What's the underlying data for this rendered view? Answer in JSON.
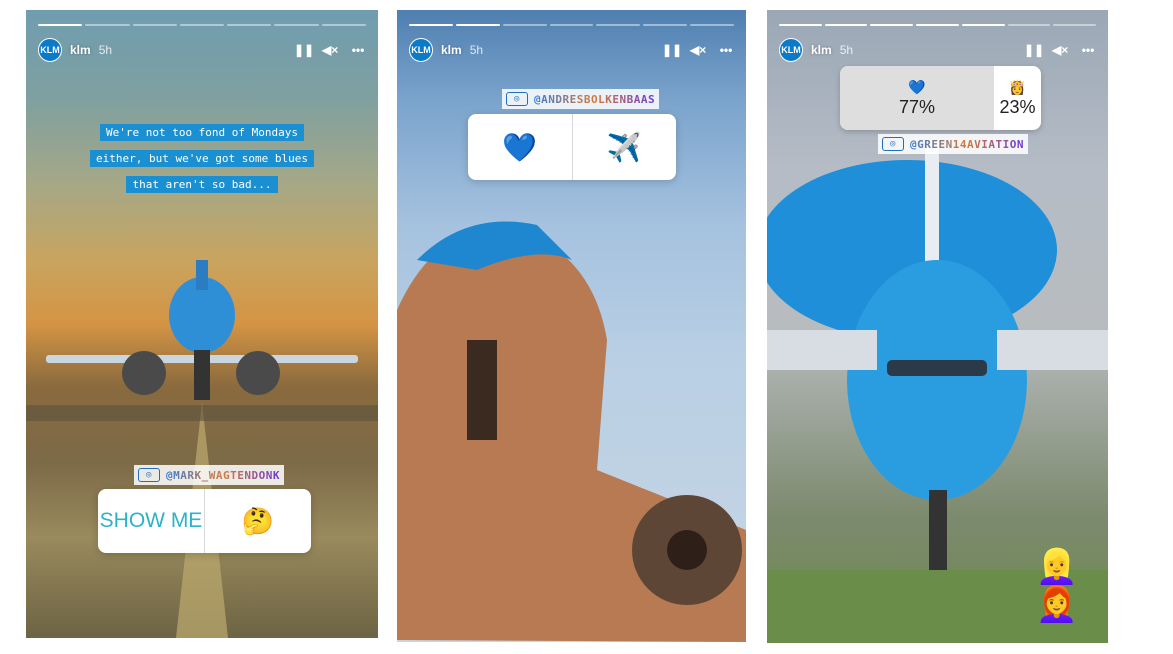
{
  "stories": [
    {
      "account": {
        "name": "klm",
        "time": "5h",
        "avatar_text": "KLM"
      },
      "progress_bars": [
        true,
        false,
        false,
        false,
        false,
        false,
        false
      ],
      "caption_lines": [
        "We're not too fond of Mondays",
        "either, but we've got some blues",
        "that aren't so bad..."
      ],
      "photo_tag": "@MARK_WAGTENDONK",
      "poll": {
        "option_1": "SHOW ME",
        "option_2": "🤔"
      }
    },
    {
      "account": {
        "name": "klm",
        "time": "5h",
        "avatar_text": "KLM"
      },
      "progress_bars": [
        true,
        true,
        false,
        false,
        false,
        false,
        false
      ],
      "photo_tag": "@ANDRESBOLKENBAAS",
      "poll": {
        "option_1": "💙",
        "option_2": "✈️"
      }
    },
    {
      "account": {
        "name": "klm",
        "time": "5h",
        "avatar_text": "KLM"
      },
      "progress_bars": [
        true,
        true,
        true,
        true,
        true,
        false,
        false
      ],
      "photo_tag": "@GREEN14AVIATION",
      "poll_results": {
        "option_1_emoji": "💙",
        "option_1_percent": "77%",
        "option_2_emoji": "👸",
        "option_2_percent": "23%"
      },
      "stickers": {
        "emoji": "👱‍♀️👩‍🦰"
      }
    }
  ],
  "icons": {
    "pause": "❚❚",
    "mute": "◀×",
    "more": "•••",
    "camera": "◎"
  },
  "colors": {
    "klm_blue": "#0a7ac9",
    "caption_bg": "#1a8fd1"
  }
}
